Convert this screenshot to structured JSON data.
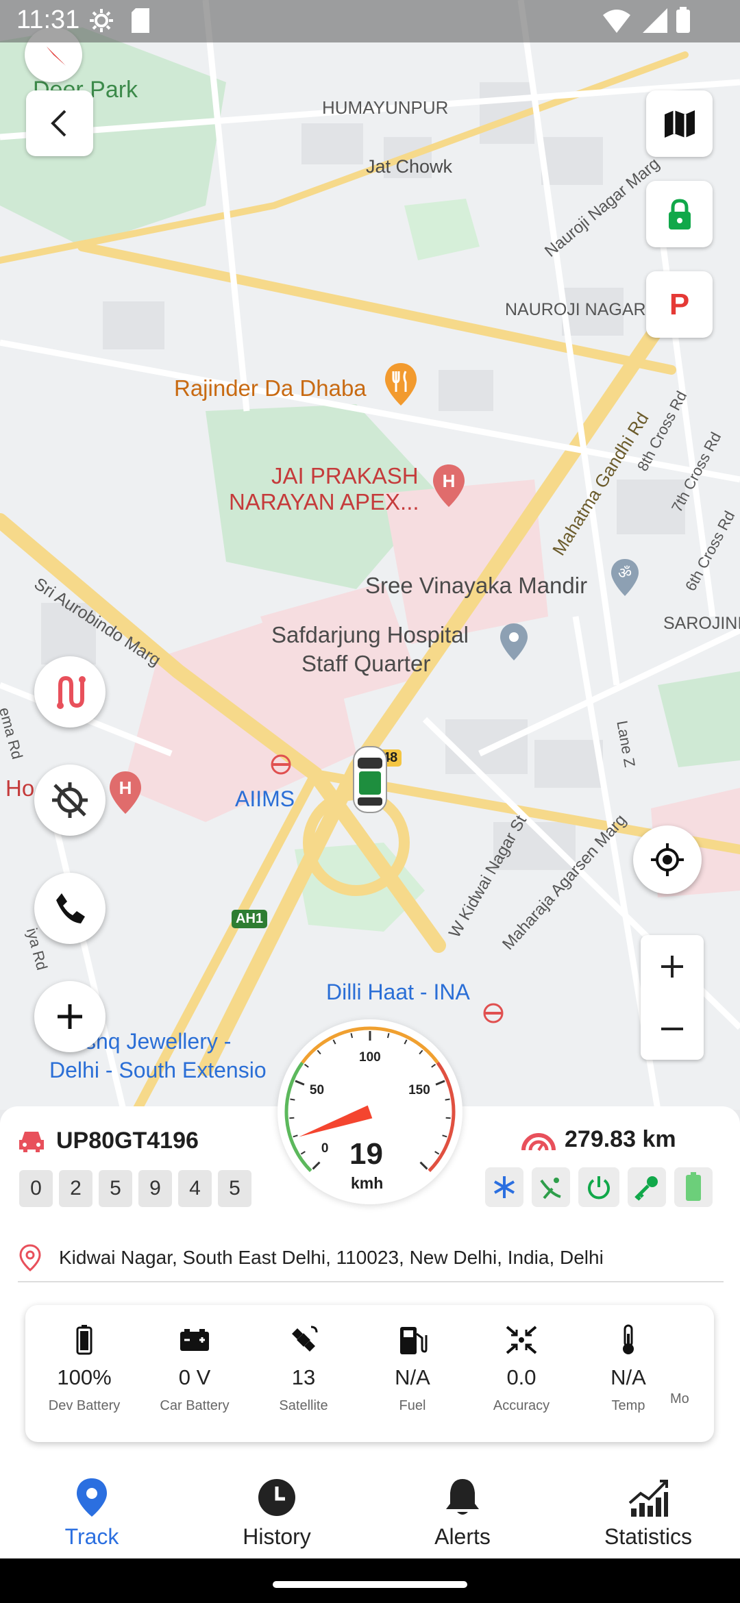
{
  "status_bar": {
    "time": "11:31"
  },
  "map": {
    "labels": {
      "deer_park": "Deer Park",
      "humayunpur": "HUMAYUNPUR",
      "jat_chowk": "Jat Chowk",
      "nauroji_marg": "Nauroji Nagar Marg",
      "nauroji_nagar": "NAUROJI NAGAR",
      "dhaba": "Rajinder Da Dhaba",
      "jai_prakash_1": "JAI PRAKASH",
      "jai_prakash_2": "NARAYAN APEX...",
      "mahatma": "Mahatma Gandhi Rd",
      "cross8": "8th Cross Rd",
      "cross7": "7th Cross Rd",
      "cross6": "6th Cross Rd",
      "vinayaka": "Sree Vinayaka Mandir",
      "aurobindo": "Sri Aurobindo Marg",
      "safdarjung_1": "Safdarjung Hospital",
      "safdarjung_2": "Staff Quarter",
      "sarojini": "SAROJINI",
      "aiims": "AIIMS",
      "lane_z": "Lane Z",
      "kidwai_st": "W Kidwai Nagar St",
      "agarsen": "Maharaja Agarsen Marg",
      "ah1": "AH1",
      "route48": "48",
      "dilli_haat": "Dilli Haat - INA",
      "jewellery_1": "shq Jewellery -",
      "jewellery_2": "Delhi - South Extensio",
      "ho": "Ho",
      "ema_rd": "ema Rd",
      "iya_rd": "iya Rd"
    },
    "parking_label": "P"
  },
  "vehicle": {
    "plate": "UP80GT4196",
    "odometer_digits": [
      "0",
      "2",
      "5",
      "9",
      "4",
      "5"
    ],
    "distance": "279.83 km",
    "address": "Kidwai Nagar, South East Delhi, 110023, New Delhi, India, Delhi"
  },
  "speedometer": {
    "ticks": [
      "0",
      "50",
      "100",
      "150"
    ],
    "speed": "19",
    "unit": "kmh",
    "max": 200
  },
  "stats": [
    {
      "value": "100%",
      "label": "Dev Battery",
      "icon": "battery-full-icon"
    },
    {
      "value": "0 V",
      "label": "Car Battery",
      "icon": "car-battery-icon"
    },
    {
      "value": "13",
      "label": "Satellite",
      "icon": "satellite-icon"
    },
    {
      "value": "N/A",
      "label": "Fuel",
      "icon": "fuel-pump-icon"
    },
    {
      "value": "0.0",
      "label": "Accuracy",
      "icon": "accuracy-arrows-icon"
    },
    {
      "value": "N/A",
      "label": "Temp",
      "icon": "thermometer-icon"
    },
    {
      "value": "",
      "label": "Mo",
      "icon": ""
    }
  ],
  "nav": {
    "track": "Track",
    "history": "History",
    "alerts": "Alerts",
    "statistics": "Statistics"
  },
  "colors": {
    "accent": "#2b6fe0",
    "plate_icon": "#e8505b",
    "lock_green": "#11a84a",
    "parking_red": "#e53935",
    "route_red": "#e8505b",
    "needle": "#f4452f"
  }
}
